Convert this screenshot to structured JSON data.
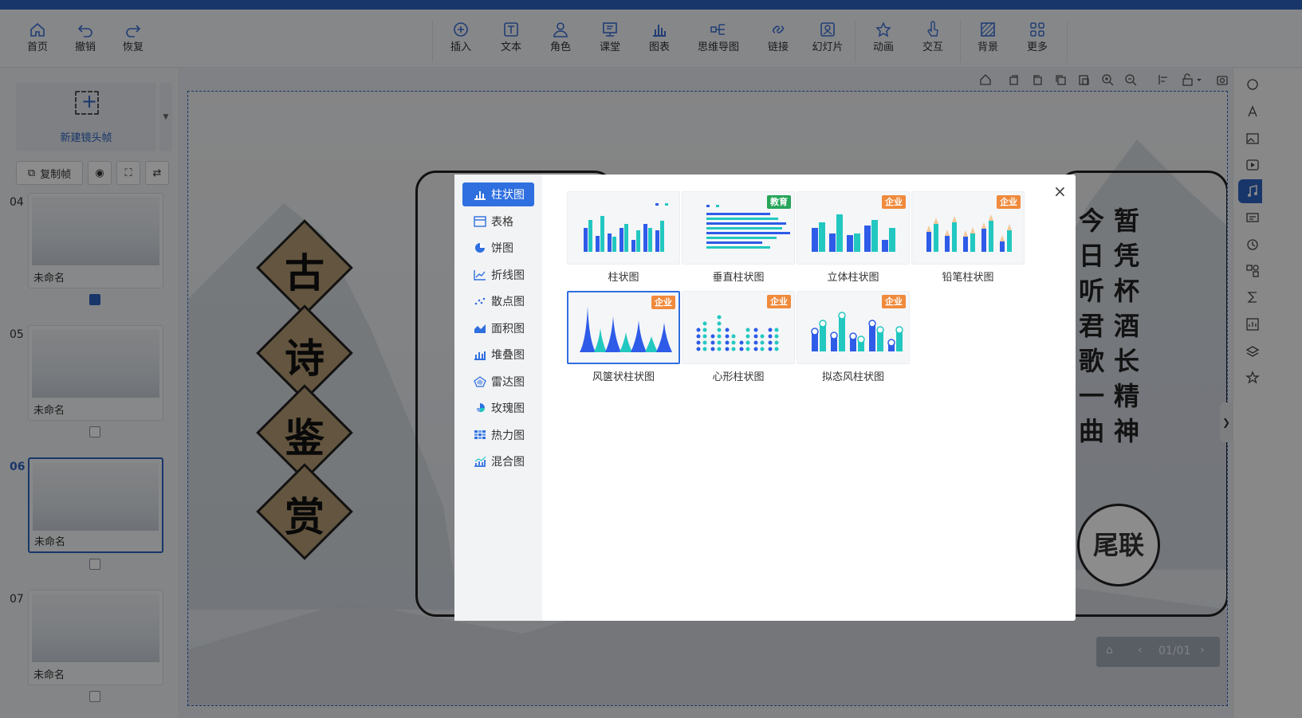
{
  "toolbar": {
    "items": [
      {
        "label": "首页",
        "icon": "home-icon"
      },
      {
        "label": "撤销",
        "icon": "undo-icon"
      },
      {
        "label": "恢复",
        "icon": "redo-icon"
      },
      {
        "label": "插入",
        "icon": "plus-circle-icon"
      },
      {
        "label": "文本",
        "icon": "text-icon"
      },
      {
        "label": "角色",
        "icon": "person-icon"
      },
      {
        "label": "课堂",
        "icon": "classroom-icon"
      },
      {
        "label": "图表",
        "icon": "bar-chart-icon"
      },
      {
        "label": "思维导图",
        "icon": "mindmap-icon"
      },
      {
        "label": "链接",
        "icon": "link-icon"
      },
      {
        "label": "幻灯片",
        "icon": "slides-icon"
      },
      {
        "label": "动画",
        "icon": "star-icon"
      },
      {
        "label": "交互",
        "icon": "pointer-icon"
      },
      {
        "label": "背景",
        "icon": "background-icon"
      },
      {
        "label": "更多",
        "icon": "grid-icon"
      }
    ]
  },
  "left_panel": {
    "new_frame_label": "新建镜头帧",
    "copy_frame_label": "复制帧",
    "slides": [
      {
        "num": "04",
        "name": "未命名",
        "active": false
      },
      {
        "num": "05",
        "name": "未命名",
        "active": false
      },
      {
        "num": "06",
        "name": "未命名",
        "active": true
      },
      {
        "num": "07",
        "name": "未命名",
        "active": false
      }
    ]
  },
  "stage": {
    "diamond_chars": [
      "古",
      "诗",
      "鉴",
      "赏"
    ],
    "poem_col_left": [
      "今",
      "日",
      "听",
      "君",
      "歌",
      "一",
      "曲"
    ],
    "poem_col_right": [
      "暂",
      "凭",
      "杯",
      "酒",
      "长",
      "精",
      "神"
    ],
    "badge": "尾联",
    "page_indicator": "01/01"
  },
  "modal": {
    "categories": [
      {
        "label": "柱状图",
        "selected": true
      },
      {
        "label": "表格",
        "selected": false
      },
      {
        "label": "饼图",
        "selected": false
      },
      {
        "label": "折线图",
        "selected": false
      },
      {
        "label": "散点图",
        "selected": false
      },
      {
        "label": "面积图",
        "selected": false
      },
      {
        "label": "堆叠图",
        "selected": false
      },
      {
        "label": "雷达图",
        "selected": false
      },
      {
        "label": "玫瑰图",
        "selected": false
      },
      {
        "label": "热力图",
        "selected": false
      },
      {
        "label": "混合图",
        "selected": false
      }
    ],
    "charts": [
      {
        "label": "柱状图",
        "tag": ""
      },
      {
        "label": "垂直柱状图",
        "tag": "教育"
      },
      {
        "label": "立体柱状图",
        "tag": "企业"
      },
      {
        "label": "铅笔柱状图",
        "tag": "企业"
      },
      {
        "label": "风箧状柱状图",
        "tag": "企业"
      },
      {
        "label": "心形柱状图",
        "tag": "企业"
      },
      {
        "label": "拟态风柱状图",
        "tag": "企业"
      }
    ]
  },
  "colors": {
    "accent": "#2c63c2",
    "select": "#2f6fe0",
    "edu": "#27a55a",
    "ent": "#f08a3c",
    "bar_blue": "#2e5be8",
    "bar_teal": "#22c8c0"
  }
}
